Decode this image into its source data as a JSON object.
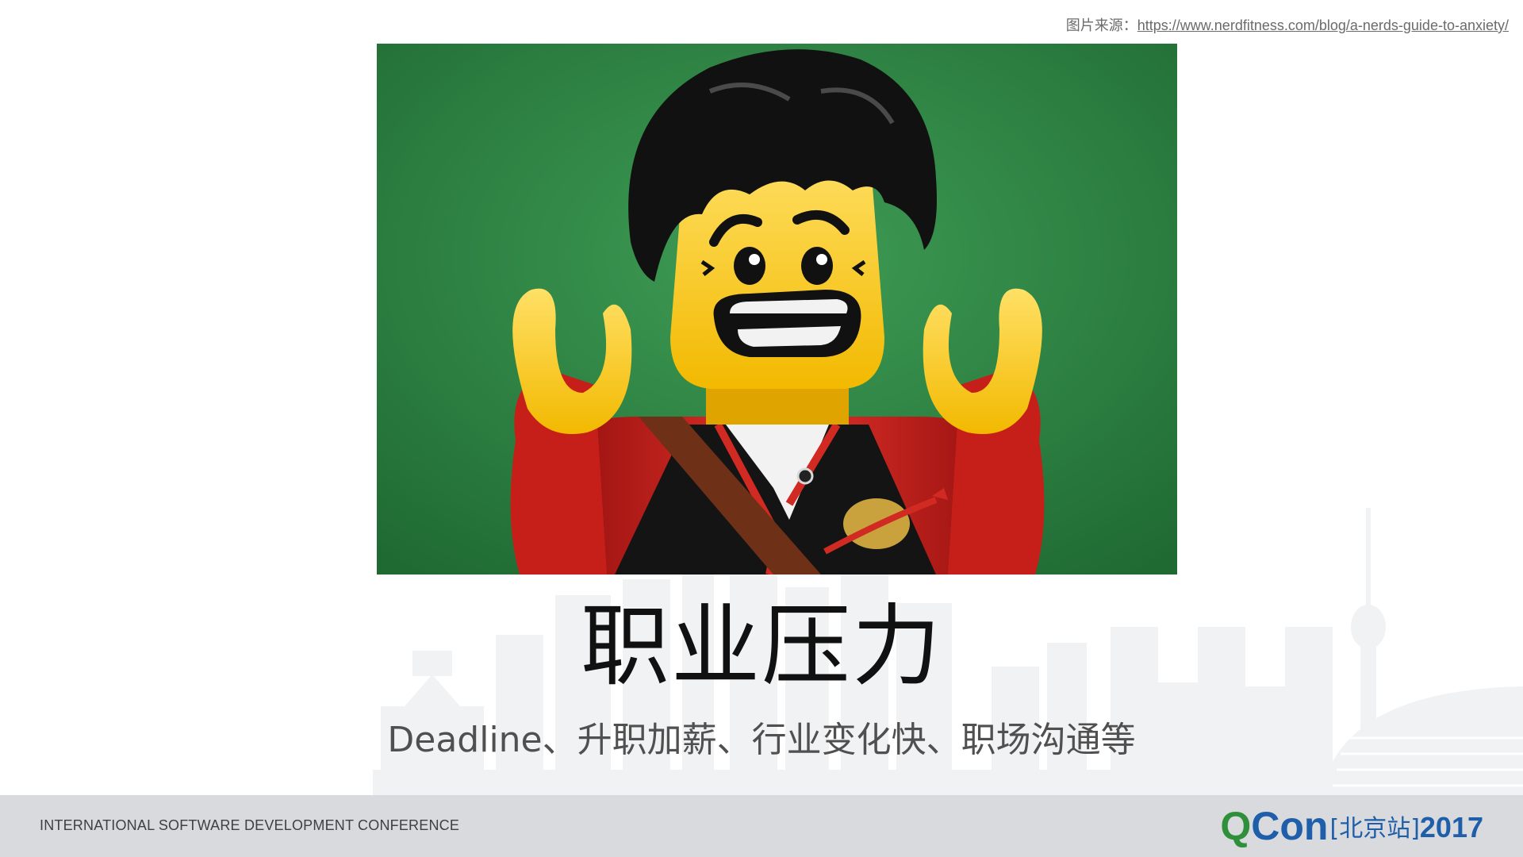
{
  "slide": {
    "source_label": "图片来源：",
    "source_url": "https://www.nerdfitness.com/blog/a-nerds-guide-to-anxiety/",
    "title": "职业压力",
    "subtitle": "Deadline、升职加薪、行业变化快、职场沟通等"
  },
  "photo": {
    "subject": "lego-minifigure-worried-icon",
    "background_color": "#2d8a43"
  },
  "footer": {
    "conference": "INTERNATIONAL SOFTWARE DEVELOPMENT CONFERENCE",
    "logo_q": "Q",
    "logo_con": "Con",
    "logo_city": "[北京站]",
    "logo_year": "2017"
  },
  "colors": {
    "footer_bg": "#d8dade",
    "logo_green": "#2f8f3b",
    "logo_blue": "#1f5ea8"
  }
}
